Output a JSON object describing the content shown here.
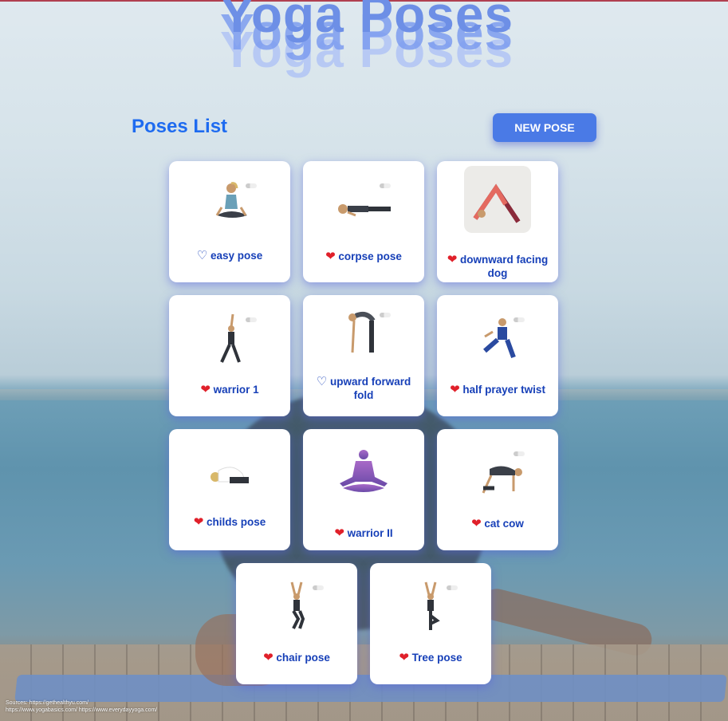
{
  "title": "Yoga Poses",
  "list_title": "Poses List",
  "new_pose_label": "NEW POSE",
  "poses": [
    {
      "name": "easy pose",
      "heart": "♡"
    },
    {
      "name": "corpse pose",
      "heart": "❤"
    },
    {
      "name": "downward facing dog",
      "heart": "❤"
    },
    {
      "name": "warrior 1",
      "heart": "❤"
    },
    {
      "name": "upward forward fold",
      "heart": "♡"
    },
    {
      "name": "half prayer twist",
      "heart": "❤"
    },
    {
      "name": "childs pose",
      "heart": "❤"
    },
    {
      "name": "warrior II",
      "heart": "❤"
    },
    {
      "name": "cat cow",
      "heart": "❤"
    },
    {
      "name": "chair pose",
      "heart": "❤"
    },
    {
      "name": "Tree pose",
      "heart": "❤"
    }
  ],
  "sources": {
    "line1": "Sources: https://gethealthyu.com/",
    "line2": "https://www.yogabasics.com/ https://www.everydayyoga.com/"
  },
  "colors": {
    "accent": "#4a7ae6",
    "title_blue": "#1e6bf0",
    "label_blue": "#1740b8",
    "heart_red": "#e0202a"
  }
}
